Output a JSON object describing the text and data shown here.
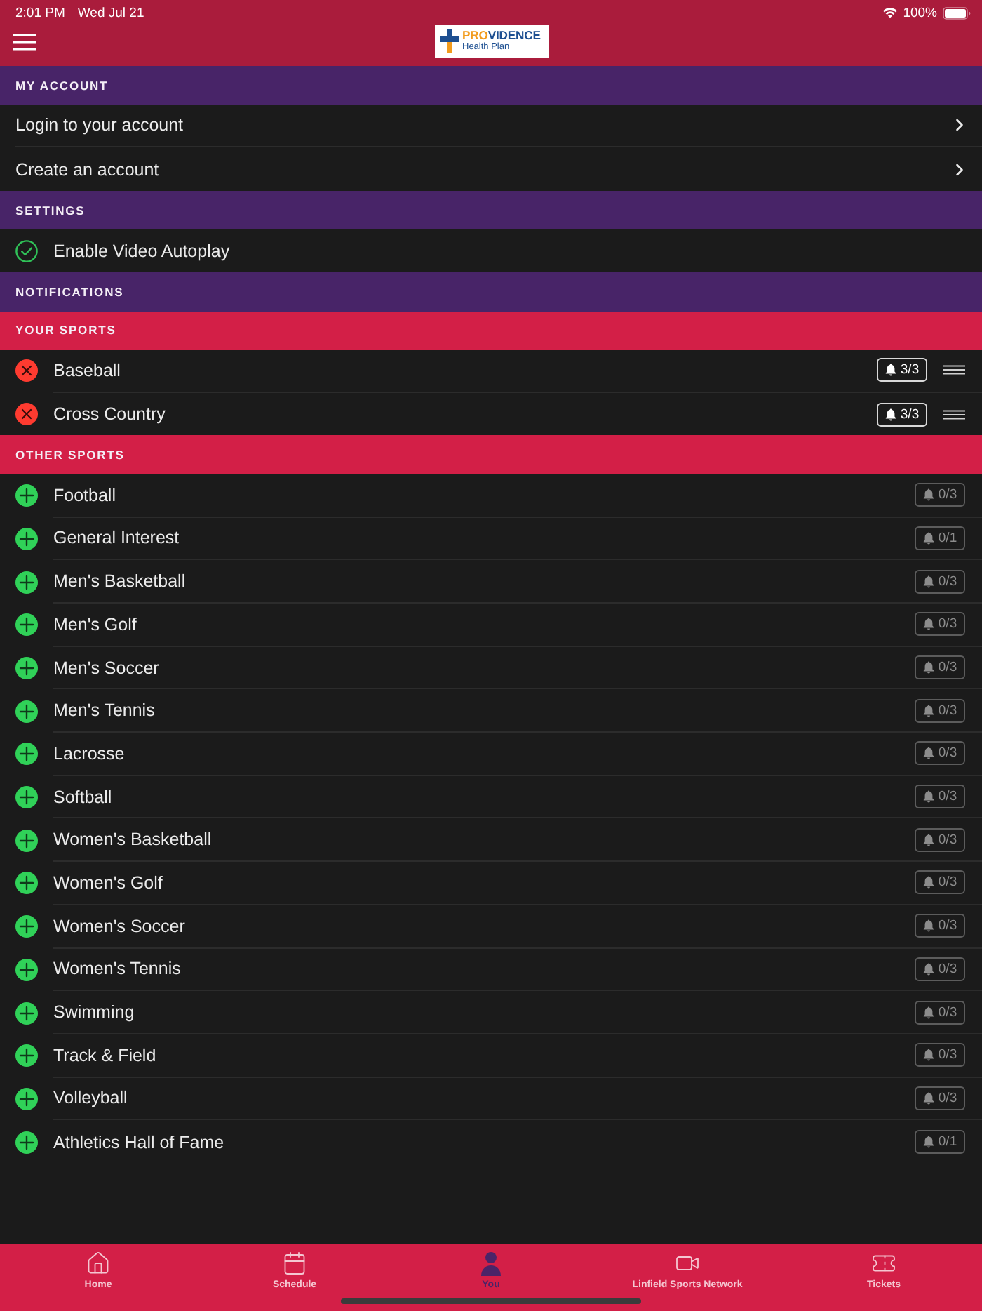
{
  "status_bar": {
    "time": "2:01 PM",
    "date": "Wed Jul 21",
    "battery": "100%"
  },
  "header": {
    "logo": {
      "name_accent": "PRO",
      "name_rest": "VIDENCE",
      "tagline": "Health Plan"
    }
  },
  "list": [
    {
      "kind": "header",
      "title": "MY ACCOUNT"
    },
    {
      "kind": "link",
      "label": "Login to your account"
    },
    {
      "kind": "link",
      "label": "Create an account"
    },
    {
      "kind": "header",
      "title": "SETTINGS"
    },
    {
      "kind": "toggle",
      "label": "Enable Video Autoplay",
      "checked": true
    },
    {
      "kind": "header",
      "title": "NOTIFICATIONS"
    },
    {
      "kind": "subheader",
      "title": "YOUR SPORTS"
    },
    {
      "kind": "sport",
      "label": "Baseball",
      "followed": true,
      "alerts": "3/3"
    },
    {
      "kind": "sport",
      "label": "Cross Country",
      "followed": true,
      "alerts": "3/3"
    },
    {
      "kind": "subheader",
      "title": "OTHER SPORTS"
    },
    {
      "kind": "sport",
      "label": "Football",
      "followed": false,
      "alerts": "0/3"
    },
    {
      "kind": "sport",
      "label": "General Interest",
      "followed": false,
      "alerts": "0/1"
    },
    {
      "kind": "sport",
      "label": "Men's Basketball",
      "followed": false,
      "alerts": "0/3"
    },
    {
      "kind": "sport",
      "label": "Men's Golf",
      "followed": false,
      "alerts": "0/3"
    },
    {
      "kind": "sport",
      "label": "Men's Soccer",
      "followed": false,
      "alerts": "0/3"
    },
    {
      "kind": "sport",
      "label": "Men's Tennis",
      "followed": false,
      "alerts": "0/3"
    },
    {
      "kind": "sport",
      "label": "Lacrosse",
      "followed": false,
      "alerts": "0/3"
    },
    {
      "kind": "sport",
      "label": "Softball",
      "followed": false,
      "alerts": "0/3"
    },
    {
      "kind": "sport",
      "label": "Women's Basketball",
      "followed": false,
      "alerts": "0/3"
    },
    {
      "kind": "sport",
      "label": "Women's Golf",
      "followed": false,
      "alerts": "0/3"
    },
    {
      "kind": "sport",
      "label": "Women's Soccer",
      "followed": false,
      "alerts": "0/3"
    },
    {
      "kind": "sport",
      "label": "Women's Tennis",
      "followed": false,
      "alerts": "0/3"
    },
    {
      "kind": "sport",
      "label": "Swimming",
      "followed": false,
      "alerts": "0/3"
    },
    {
      "kind": "sport",
      "label": "Track & Field",
      "followed": false,
      "alerts": "0/3"
    },
    {
      "kind": "sport",
      "label": "Volleyball",
      "followed": false,
      "alerts": "0/3"
    },
    {
      "kind": "sport",
      "label": "Athletics Hall of Fame",
      "followed": false,
      "alerts": "0/1"
    }
  ],
  "tab_bar": {
    "tabs": [
      {
        "label": "Home",
        "selected": false
      },
      {
        "label": "Schedule",
        "selected": false
      },
      {
        "label": "You",
        "selected": true
      },
      {
        "label": "Linfield Sports Network",
        "selected": false
      },
      {
        "label": "Tickets",
        "selected": false
      }
    ]
  }
}
